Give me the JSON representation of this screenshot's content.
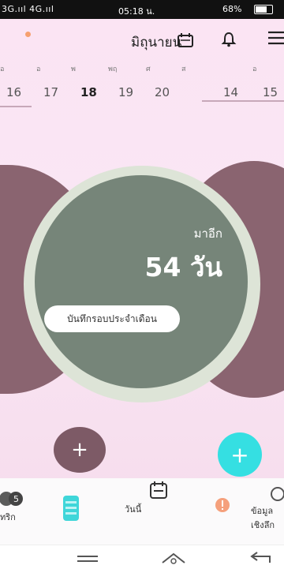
{
  "status": {
    "signal": "3G.ııl 4G.ııl",
    "time": "05:18 น.",
    "battery": "68%"
  },
  "header": {
    "month": "มิถุนายน"
  },
  "calendar": {
    "weekdays": [
      "อ",
      "อ",
      "พ",
      "พฤ",
      "ศ",
      "ส",
      "อ"
    ],
    "left_weekdays_visible": 6,
    "dates_left": [
      "16",
      "17",
      "18",
      "19",
      "20"
    ],
    "selected_date": "18",
    "dates_right": [
      "14",
      "15"
    ]
  },
  "status_circle": {
    "label": "มาอีก",
    "days": "54 วัน",
    "button": "บันทึกรอบประจำเดือน"
  },
  "nav": {
    "items": [
      {
        "label": "ทริก"
      },
      {
        "label": ""
      },
      {
        "label": "วันนี้"
      },
      {
        "label": ""
      },
      {
        "label": "ข้อมูลเชิงลึก"
      }
    ]
  },
  "colors": {
    "accent": "#35dfe2",
    "circle": "#768579",
    "blob": "#8a6470",
    "background": "#f8e6f3"
  }
}
